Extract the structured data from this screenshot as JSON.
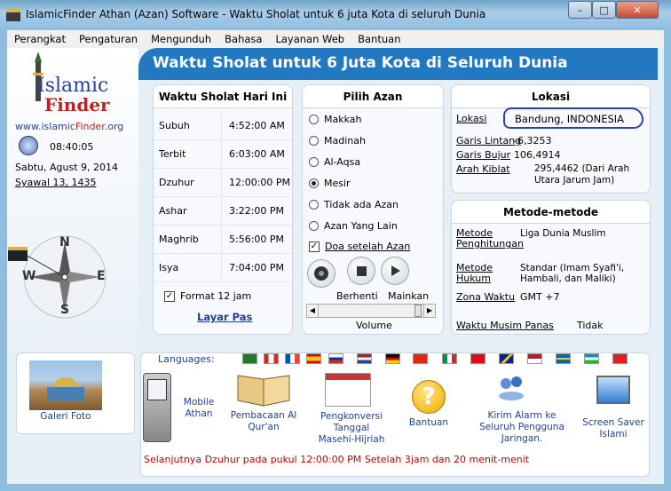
{
  "window": {
    "title": "IslamicFinder Athan (Azan) Software - Waktu Sholat untuk 6 juta Kota di seluruh Dunia",
    "min": "–",
    "max": "□",
    "close": "✕"
  },
  "menu": [
    "Perangkat",
    "Pengaturan",
    "Mengunduh",
    "Bahasa",
    "Layanan Web",
    "Bantuan"
  ],
  "logo": {
    "line1": "Islamic",
    "line2": "Finder",
    "url_pre": "www.islamic",
    "url_mid": "Finder",
    "url_post": ".org"
  },
  "clock": {
    "time": "08:40:05",
    "date": "Sabtu, Agust 9, 2014",
    "hijri": "Syawal 13, 1435"
  },
  "compass": {
    "letters": {
      "n": "N",
      "s": "S",
      "e": "E",
      "w": "W"
    }
  },
  "banner": "Waktu Sholat untuk 6 Juta Kota di Seluruh Dunia",
  "prayer_panel": {
    "title": "Waktu Sholat Hari Ini",
    "rows": [
      {
        "name": "Subuh",
        "time": "4:52:00 AM"
      },
      {
        "name": "Terbit",
        "time": "6:03:00 AM"
      },
      {
        "name": "Dzuhur",
        "time": "12:00:00 PM"
      },
      {
        "name": "Ashar",
        "time": "3:22:00 PM"
      },
      {
        "name": "Maghrib",
        "time": "5:56:00 PM"
      },
      {
        "name": "Isya",
        "time": "7:04:00 PM"
      }
    ],
    "format12": "Format 12 jam",
    "fullscreen": "Layar Pas"
  },
  "azan_panel": {
    "title": "Pilih Azan",
    "options": [
      "Makkah",
      "Madinah",
      "Al-Aqsa",
      "Mesir",
      "Tidak ada Azan",
      "Azan Yang Lain"
    ],
    "selected": "Mesir",
    "doa": "Doa setelah Azan",
    "stop": "Berhenti",
    "play": "Mainkan",
    "volume": "Volume"
  },
  "location_panel": {
    "title": "Lokasi",
    "rows": [
      {
        "label": "Lokasi",
        "value": "Bandung, INDONESIA"
      },
      {
        "label": "Garis Lintang",
        "value": "-6,3253"
      },
      {
        "label": "Garis Bujur",
        "value": "106,4914"
      },
      {
        "label": "Arah Kiblat",
        "value": "295,4462 (Dari Arah Utara Jarum Jam)"
      }
    ]
  },
  "methods_panel": {
    "title": "Metode-metode",
    "rows": [
      {
        "label": "Metode Penghitungan",
        "value": "Liga Dunia Muslim"
      },
      {
        "label": "Metode Hukum",
        "value": "Standar (Imam Syafi'i, Hambali, dan Maliki)"
      },
      {
        "label": "Zona Waktu",
        "value": "GMT +7"
      },
      {
        "label": "Waktu Musim Panas",
        "value": "Tidak"
      }
    ]
  },
  "languages_label": "Languages:",
  "tools": {
    "galeri": "Galeri Foto",
    "mobile": "Mobile Athan",
    "quran": "Pembacaan Al Qur'an",
    "converter": "Pengkonversi Tanggal Masehi-Hijriah",
    "help": "Bantuan",
    "alarm": "Kirim Alarm ke Seluruh Pengguna Jaringan.",
    "screensaver": "Screen Saver Islami"
  },
  "status": "Selanjutnya Dzuhur pada pukul 12:00:00 PM Setelah 3jam dan 20 menit-menit",
  "colors": {
    "banner": "#2279c1",
    "status": "#c80000",
    "link": "#1d3f9a"
  }
}
